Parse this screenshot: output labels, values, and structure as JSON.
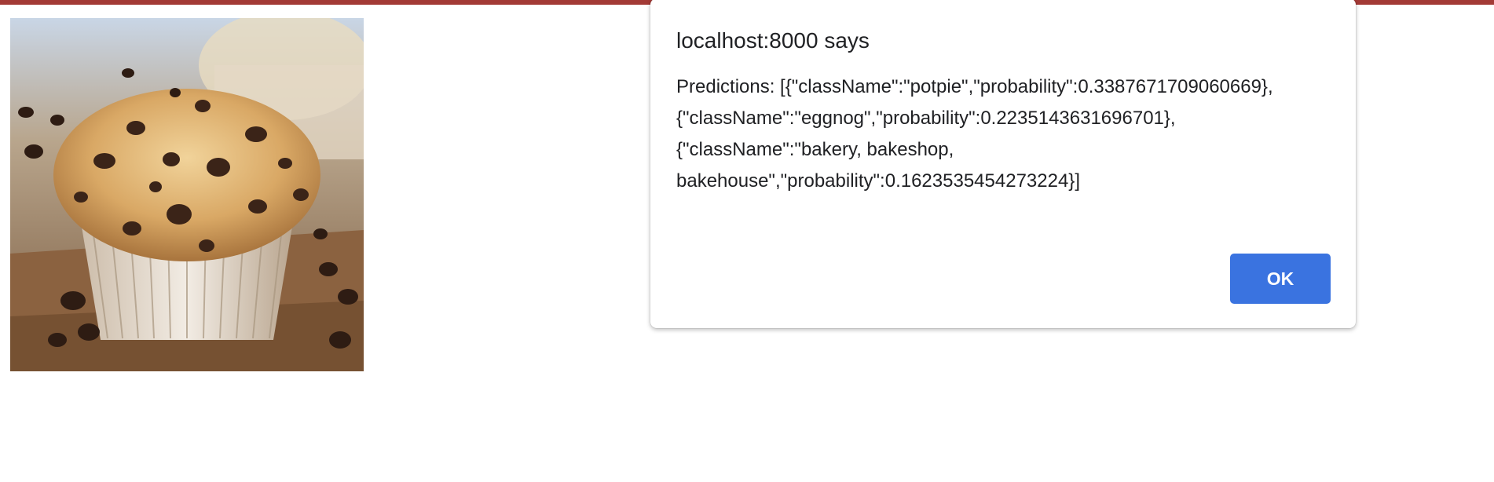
{
  "dialog": {
    "title": "localhost:8000 says",
    "message_lines": [
      "Predictions: [{\"className\":\"potpie\",\"probability\":0.3387671709060669},",
      "{\"className\":\"eggnog\",\"probability\":0.2235143631696701},",
      "{\"className\":\"bakery, bakeshop,",
      "bakehouse\",\"probability\":0.1623535454273224}]"
    ],
    "ok_label": "OK"
  },
  "colors": {
    "top_bar": "#a33a36",
    "ok_button": "#3a73e0"
  }
}
